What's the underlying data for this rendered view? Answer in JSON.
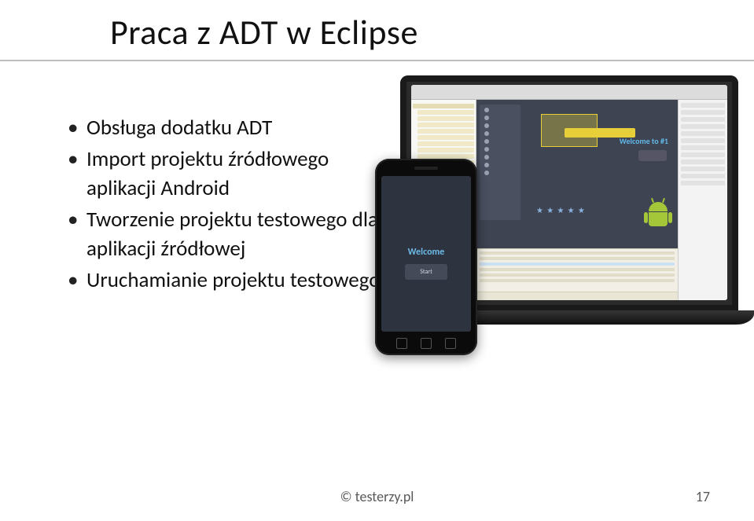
{
  "title": "Praca z ADT w Eclipse",
  "bullets": [
    "Obsługa dodatku ADT",
    "Import projektu źródłowego aplikacji Android",
    "Tworzenie projektu testowego dla aplikacji źródłowej",
    "Uruchamianie projektu testowego"
  ],
  "screenshot": {
    "laptop_welcome": "Welcome to #1",
    "phone_welcome": "Welcome",
    "phone_start": "Start"
  },
  "footer": {
    "copyright": "© testerzy.pl",
    "page": "17"
  }
}
